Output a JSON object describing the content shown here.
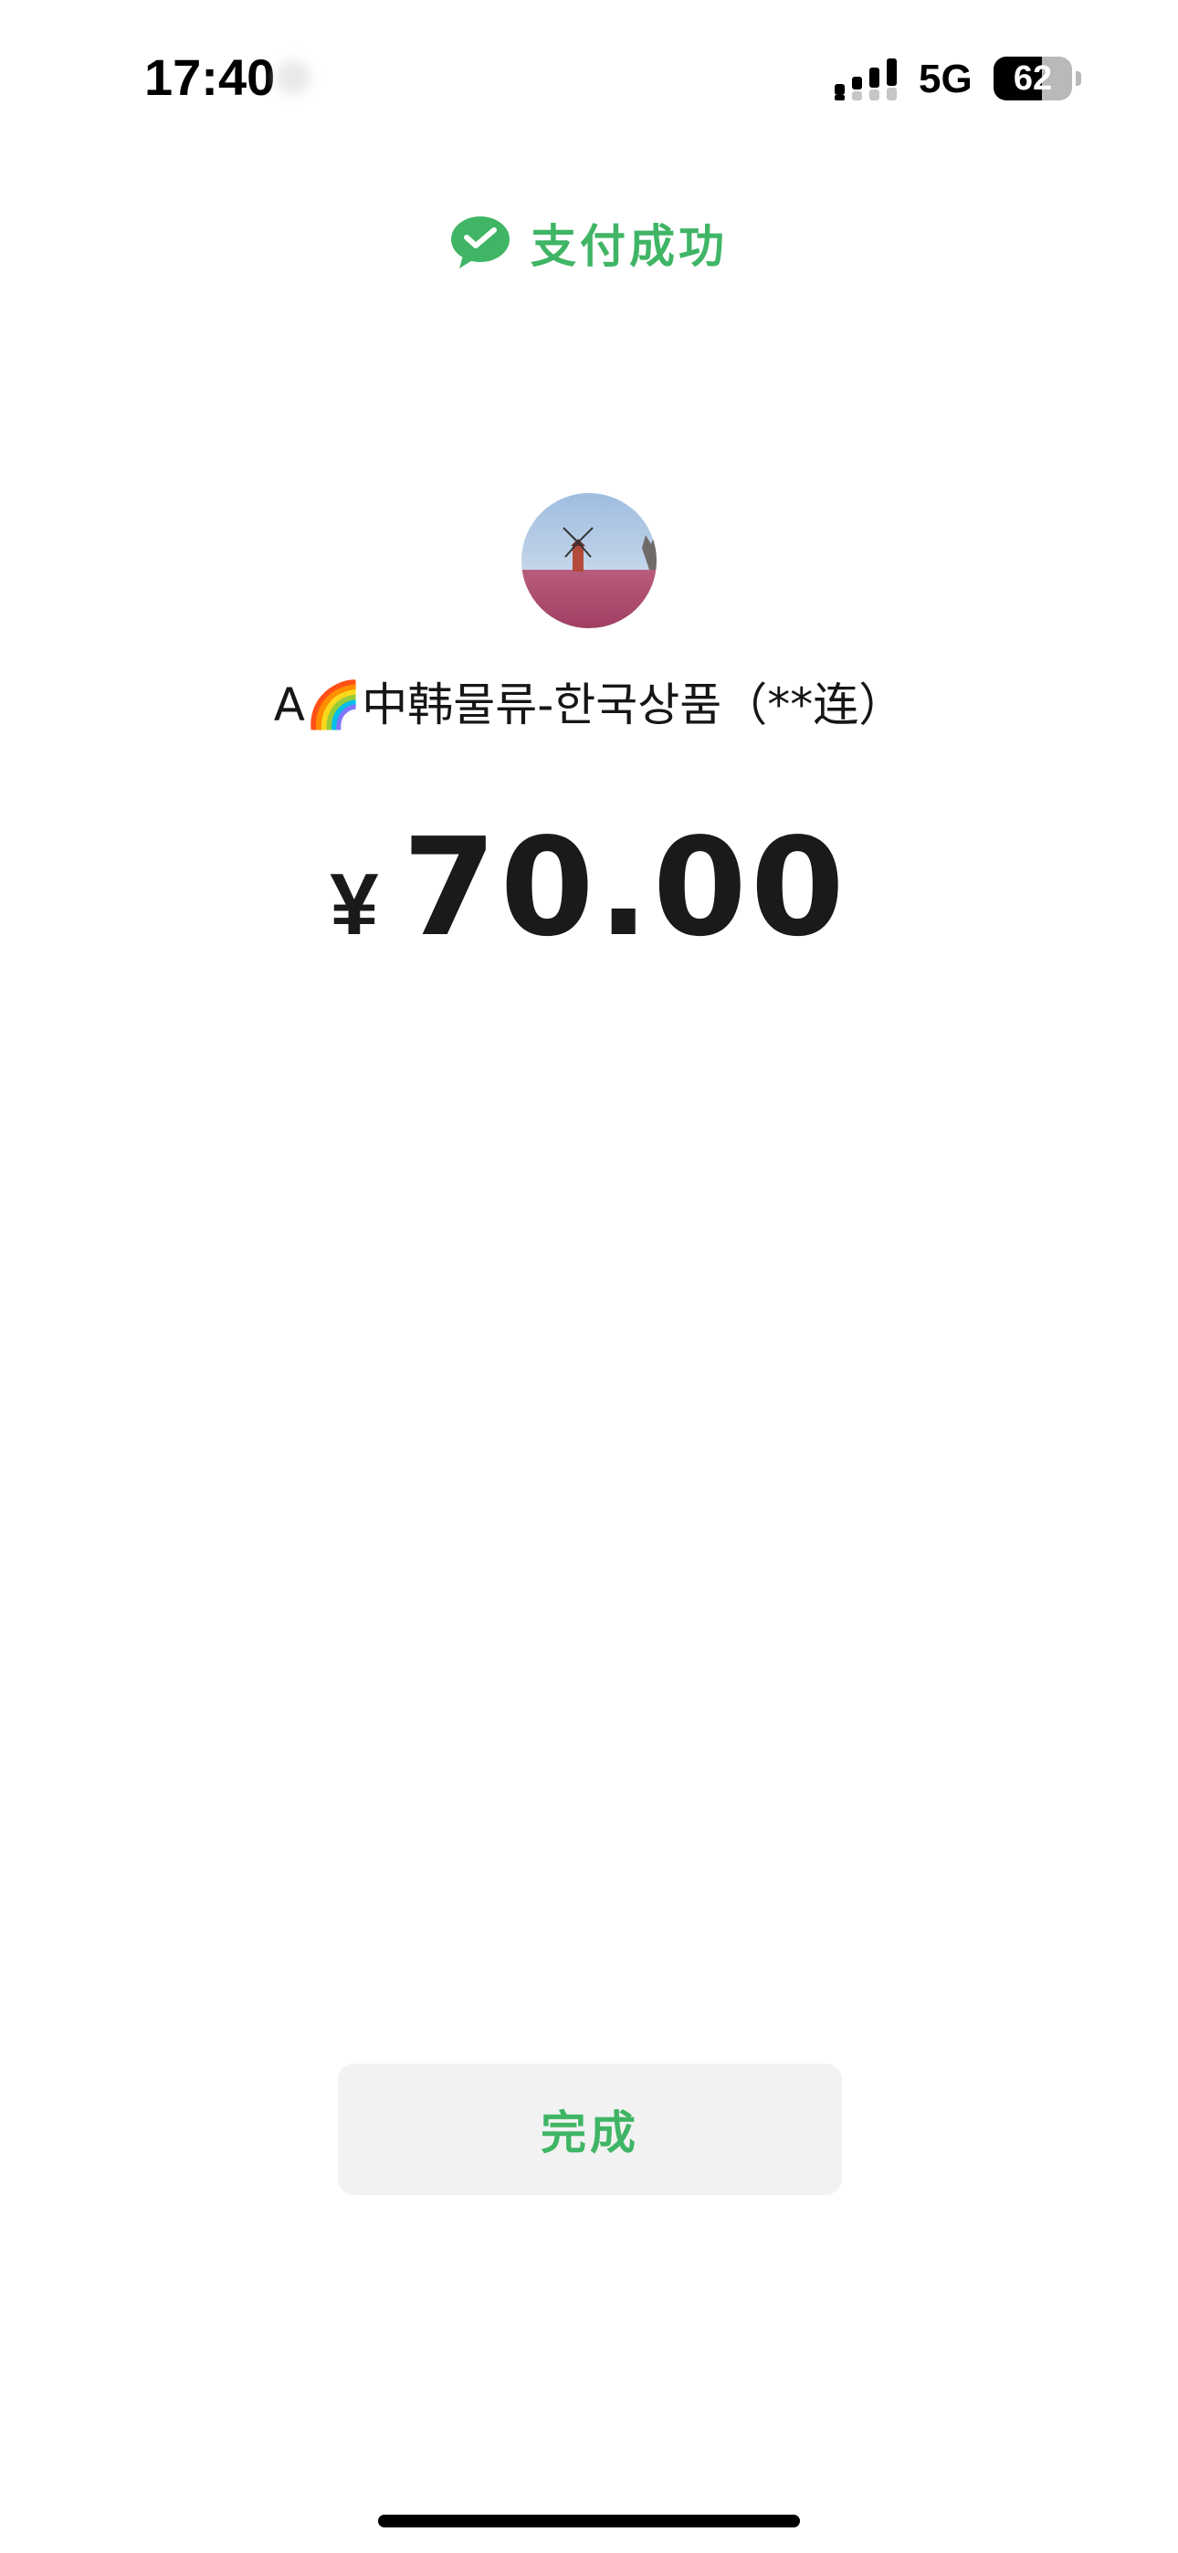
{
  "status_bar": {
    "time": "17:40",
    "network": "5G",
    "battery": "62",
    "battery_level": 0.62,
    "signal_bars_active": 2
  },
  "header": {
    "title": "支付成功",
    "icon": "wechat-pay-icon",
    "accent_color": "#3fb565"
  },
  "merchant": {
    "avatar": "windmill-avatar",
    "name": "A🌈中韩물류-한국상품（**连）"
  },
  "payment": {
    "currency_symbol": "¥",
    "amount": "70.00"
  },
  "actions": {
    "done_label": "完成"
  }
}
